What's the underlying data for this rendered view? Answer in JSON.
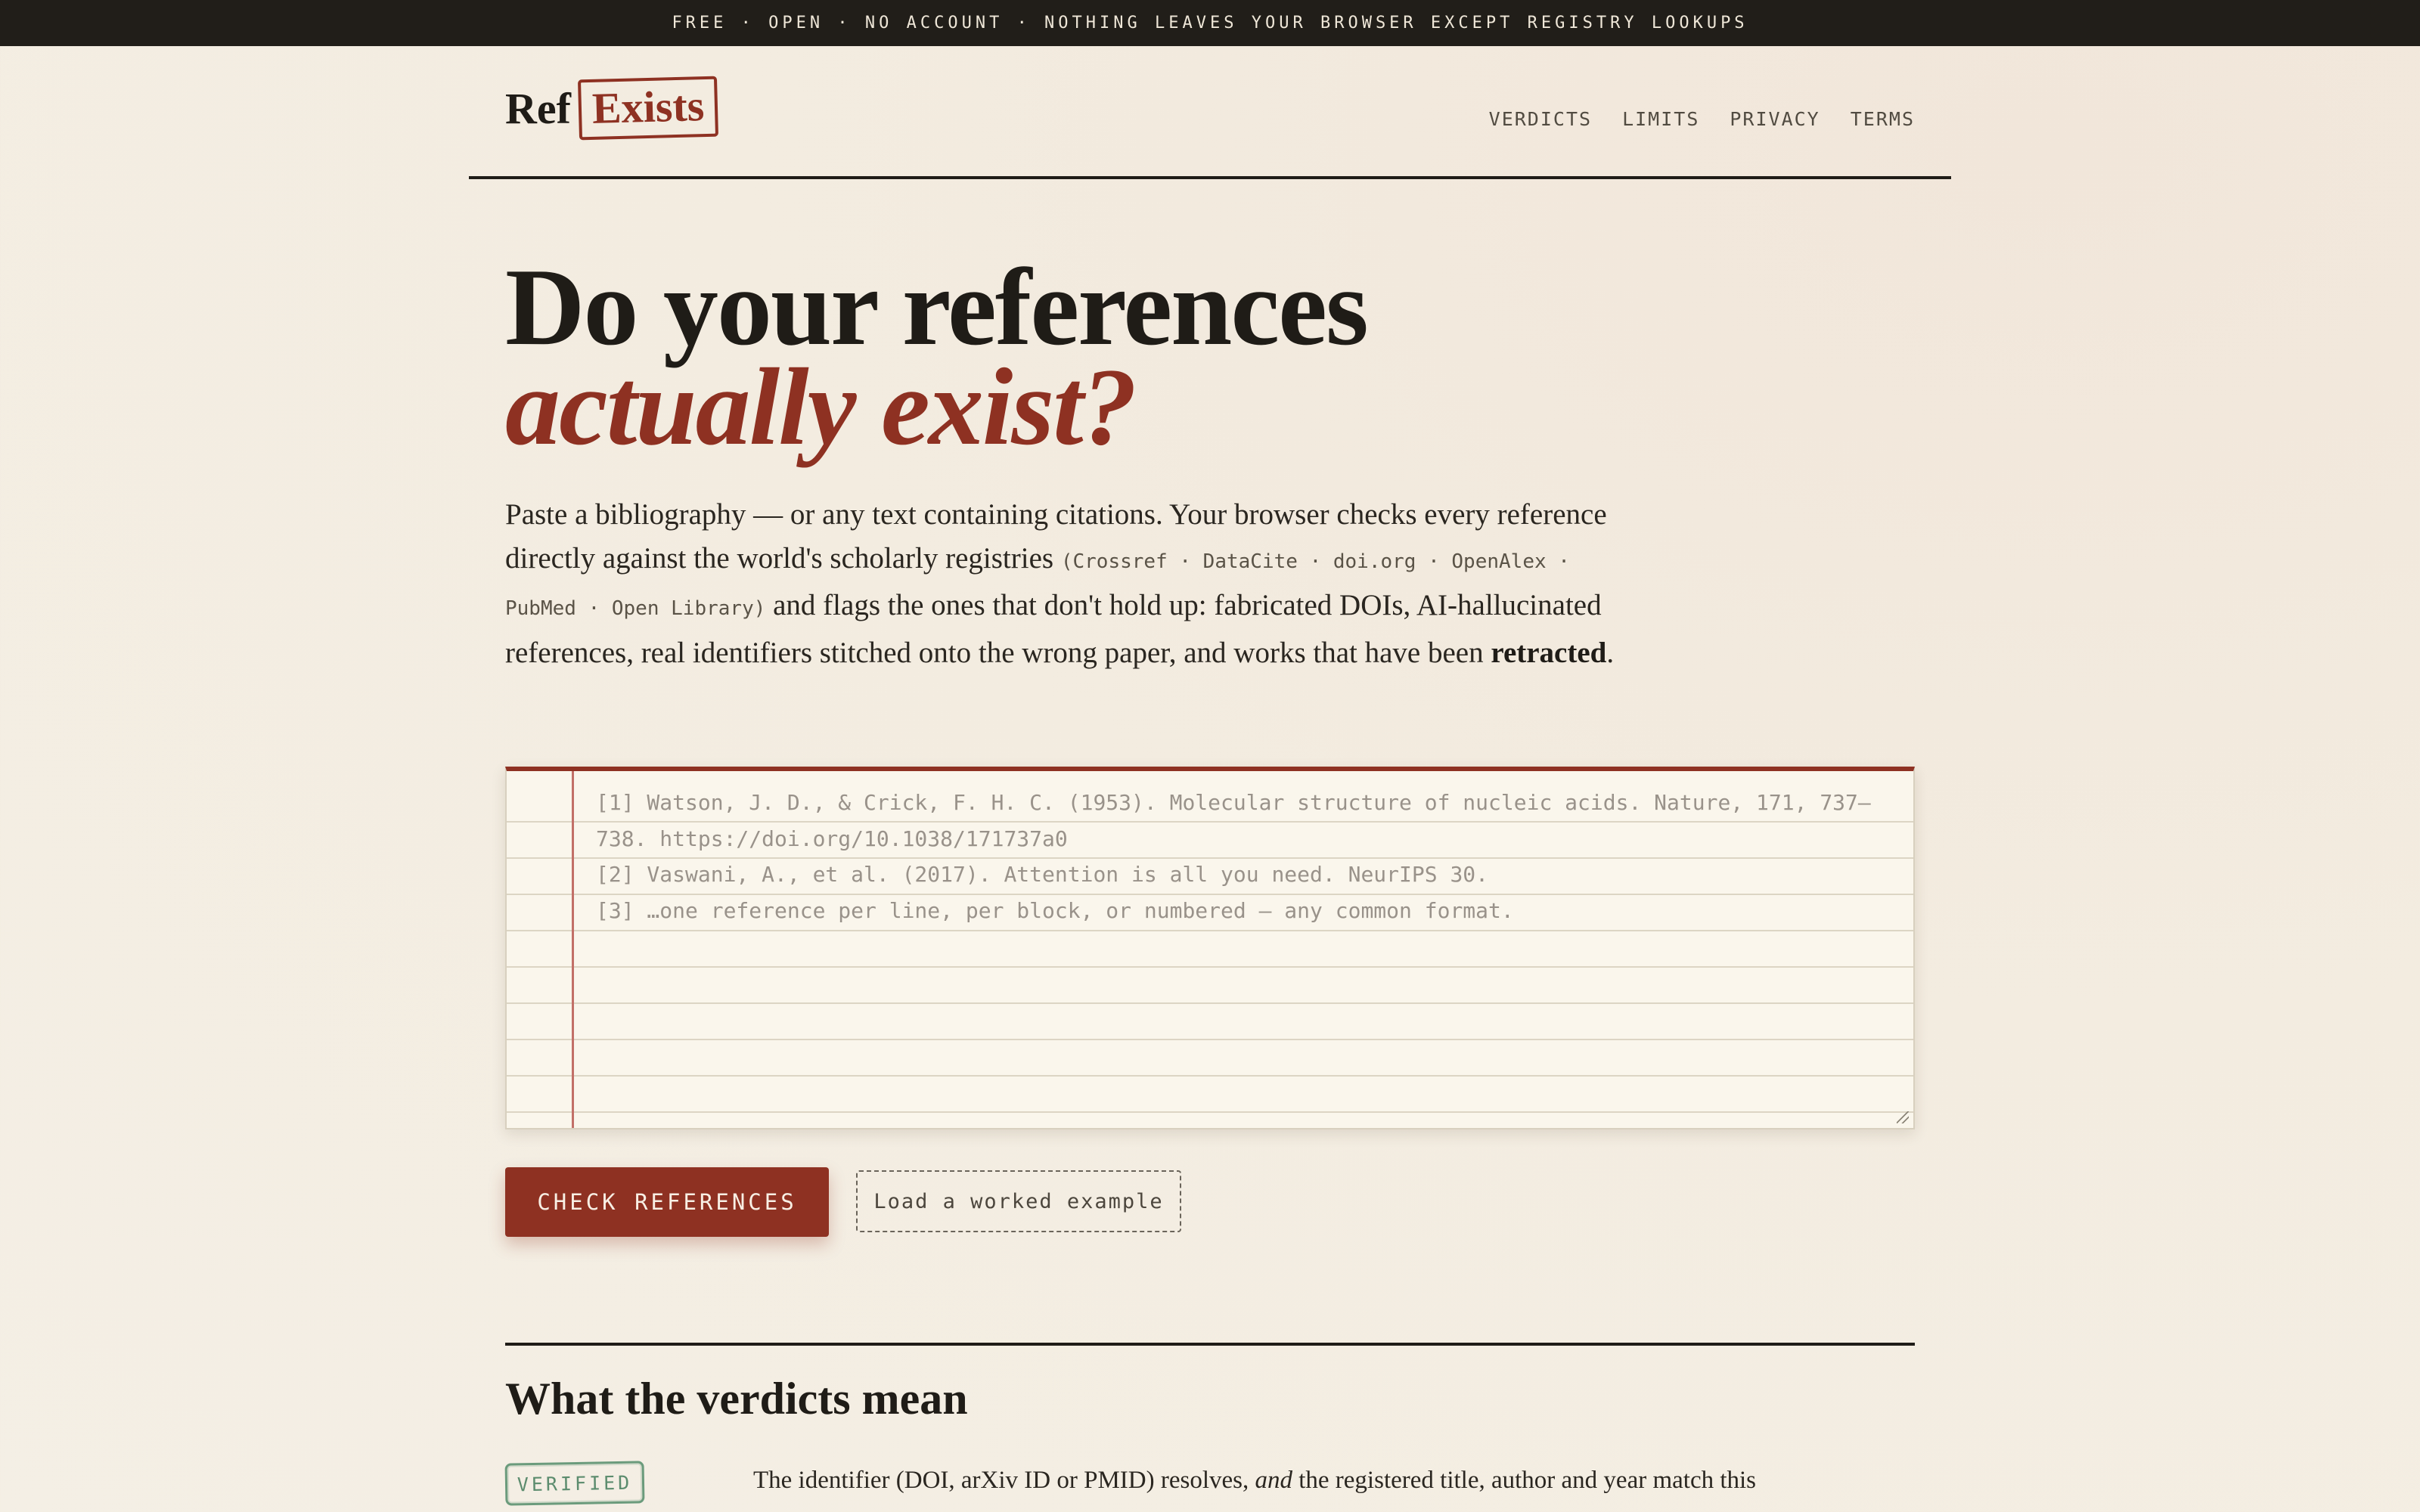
{
  "topbar": {
    "text": "FREE · OPEN · NO ACCOUNT · NOTHING LEAVES YOUR BROWSER EXCEPT REGISTRY LOOKUPS"
  },
  "logo": {
    "part1": "Ref",
    "part2": "Exists"
  },
  "nav": [
    "VERDICTS",
    "LIMITS",
    "PRIVACY",
    "TERMS"
  ],
  "hero": {
    "line1": "Do your references",
    "line2": "actually exist?"
  },
  "intro": {
    "p1": "Paste a bibliography — or any text containing citations. Your browser checks every reference directly against the world's scholarly registries ",
    "registries": "(Crossref · DataCite · doi.org · OpenAlex · PubMed · Open Library)",
    "p2": " and flags the ones that don't hold up: fabricated DOIs, AI-hallucinated references, real identifiers stitched onto the wrong paper, and works that have been ",
    "bold": "retracted",
    "p3": "."
  },
  "textarea": {
    "placeholder_lines": [
      "[1] Watson, J. D., & Crick, F. H. C. (1953). Molecular structure of nucleic acids. Nature, 171, 737–738. https://doi.org/10.1038/171737a0",
      "[2] Vaswani, A., et al. (2017). Attention is all you need. NeurIPS 30.",
      "[3] …one reference per line, per block, or numbered — any common format."
    ]
  },
  "buttons": {
    "check": "CHECK REFERENCES",
    "example": "Load a worked example"
  },
  "verdicts": {
    "heading": "What the verdicts mean",
    "badge": "VERIFIED",
    "text_a": "The identifier (DOI, arXiv ID or PMID) resolves, ",
    "text_em": "and",
    "text_b": " the registered title, author and year match this citation."
  }
}
